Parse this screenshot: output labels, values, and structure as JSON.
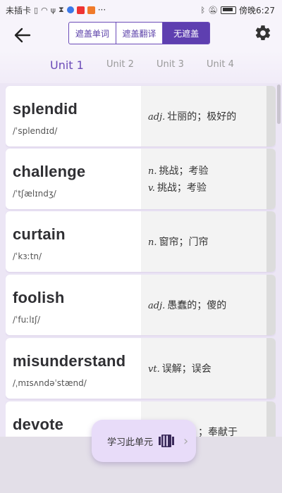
{
  "status_bar": {
    "carrier": "未插卡",
    "more": "···",
    "time": "傍晚6:27"
  },
  "header": {
    "segments": [
      {
        "label": "遮盖单词",
        "active": false
      },
      {
        "label": "遮盖翻译",
        "active": false
      },
      {
        "label": "无遮盖",
        "active": true
      }
    ],
    "accent_color": "#5e3fb0"
  },
  "tabs": [
    {
      "label": "Unit 1",
      "active": true
    },
    {
      "label": "Unit 2",
      "active": false
    },
    {
      "label": "Unit 3",
      "active": false
    },
    {
      "label": "Unit 4",
      "active": false
    }
  ],
  "words": [
    {
      "word": "splendid",
      "phonetic": "/ˈsplendɪd/",
      "defs": [
        {
          "pos": "adj.",
          "text": "壮丽的；极好的"
        }
      ]
    },
    {
      "word": "challenge",
      "phonetic": "/ˈtʃælɪndʒ/",
      "defs": [
        {
          "pos": "n.",
          "text": "挑战；考验"
        },
        {
          "pos": "v.",
          "text": "挑战；考验"
        }
      ]
    },
    {
      "word": "curtain",
      "phonetic": "/ˈkɜːtn/",
      "defs": [
        {
          "pos": "n.",
          "text": "窗帘；门帘"
        }
      ]
    },
    {
      "word": "foolish",
      "phonetic": "/ˈfuːlɪʃ/",
      "defs": [
        {
          "pos": "adj.",
          "text": "愚蠢的；傻的"
        }
      ]
    },
    {
      "word": "misunderstand",
      "phonetic": "/ˌmɪsʌndəˈstænd/",
      "defs": [
        {
          "pos": "vt.",
          "text": "误解；误会"
        }
      ]
    },
    {
      "word": "devote",
      "phonetic": "",
      "defs": [
        {
          "pos": "",
          "text": "；奉献于"
        }
      ]
    }
  ],
  "study_button": {
    "label": "学习此单元",
    "icon": "book-icon"
  }
}
